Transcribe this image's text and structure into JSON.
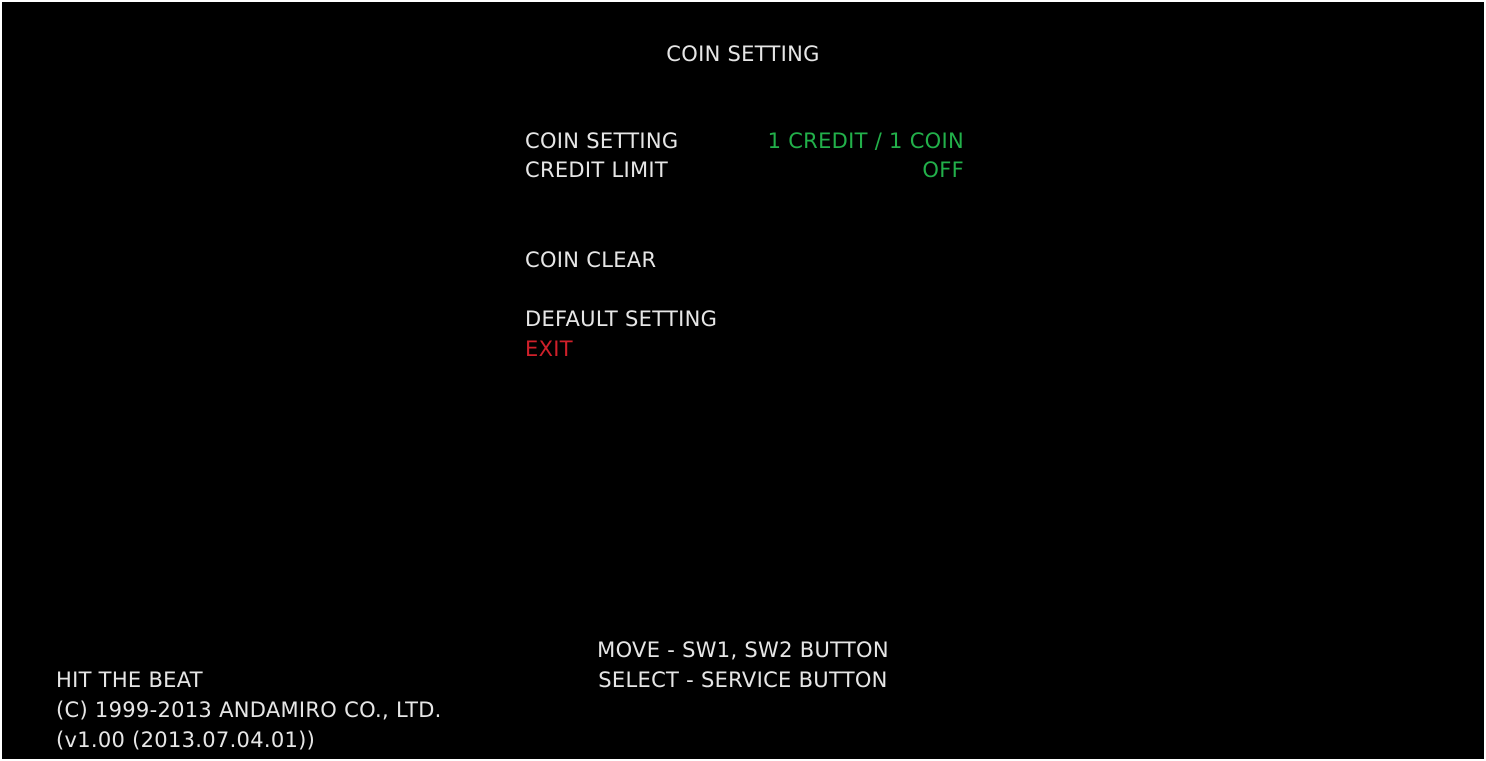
{
  "colors": {
    "background": "#000000",
    "text": "#e6e6e6",
    "value": "#22b04a",
    "exit": "#d0202a"
  },
  "screen": {
    "title": "COIN SETTING"
  },
  "menu": {
    "coin_setting": {
      "label": "COIN SETTING",
      "value": "1 CREDIT / 1 COIN"
    },
    "credit_limit": {
      "label": "CREDIT LIMIT",
      "value": "OFF"
    },
    "coin_clear": {
      "label": "COIN CLEAR"
    },
    "default_setting": {
      "label": "DEFAULT SETTING"
    },
    "exit": {
      "label": "EXIT"
    }
  },
  "help": {
    "move": "MOVE - SW1, SW2 BUTTON",
    "select": "SELECT - SERVICE BUTTON"
  },
  "footer": {
    "game_name": "HIT THE BEAT",
    "copyright": "(C) 1999-2013 ANDAMIRO CO., LTD.",
    "version": "(v1.00 (2013.07.04.01))"
  }
}
